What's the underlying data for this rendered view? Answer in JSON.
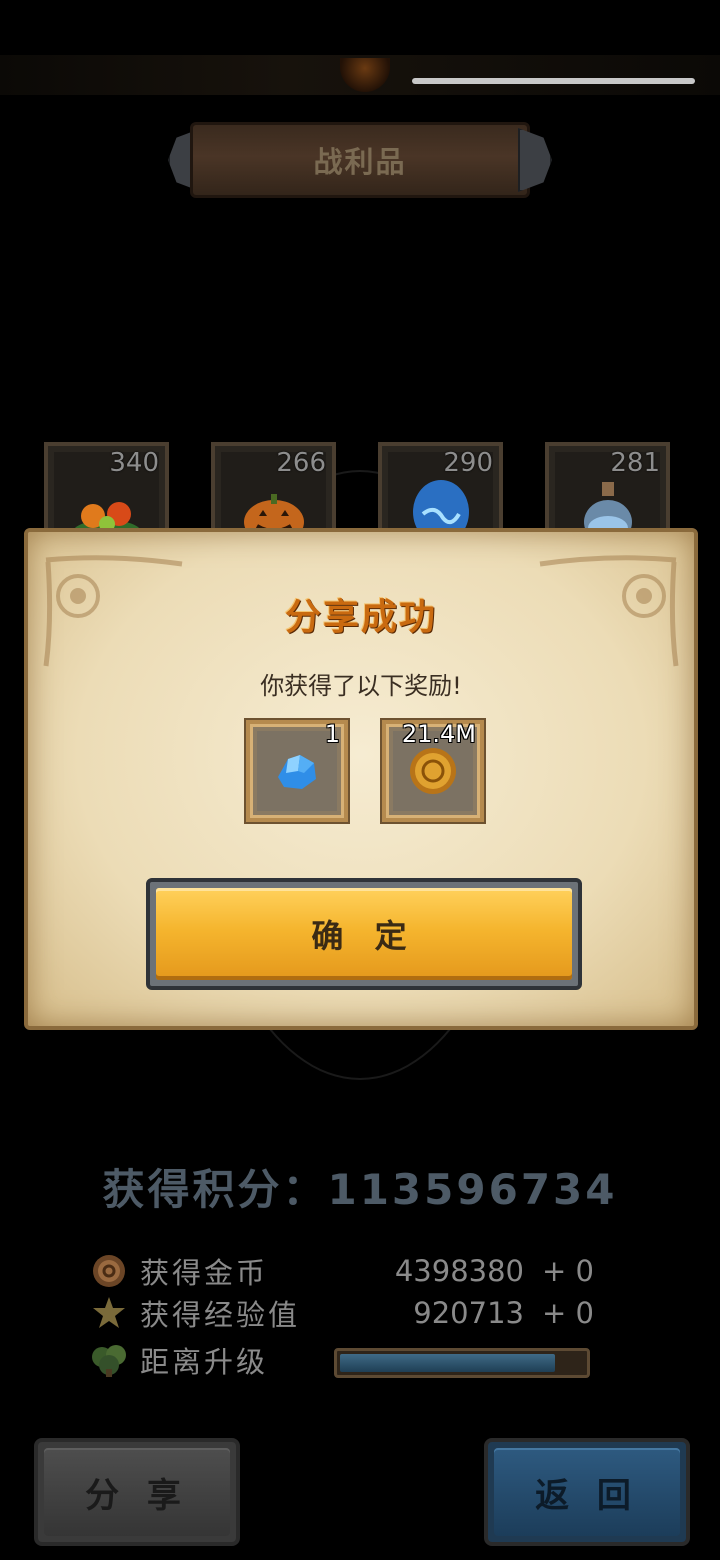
{
  "header": {
    "title": "战利品"
  },
  "loot": [
    {
      "count": "340",
      "icon": "fruit-bundle-icon"
    },
    {
      "count": "266",
      "icon": "pumpkin-icon"
    },
    {
      "count": "290",
      "icon": "blue-egg-icon"
    },
    {
      "count": "281",
      "icon": "potion-bottle-icon"
    }
  ],
  "dialog": {
    "title": "分享成功",
    "subtitle": "你获得了以下奖励!",
    "rewards": [
      {
        "qty": "1",
        "icon": "blue-crystal-icon"
      },
      {
        "qty": "21.4M",
        "icon": "gold-coin-icon"
      }
    ],
    "confirm_label": "确 定"
  },
  "score": {
    "text": "获得积分：113596734"
  },
  "stats": [
    {
      "label": "获得金币",
      "value": "4398380",
      "plus": "+ 0",
      "icon": "coin-icon"
    },
    {
      "label": "获得经验值",
      "value": "920713",
      "plus": "+ 0",
      "icon": "star-icon"
    },
    {
      "label": "距离升级",
      "progress": 0.88,
      "icon": "tree-icon"
    }
  ],
  "buttons": {
    "share_label": "分 享",
    "back_label": "返 回"
  },
  "colors": {
    "accent_orange": "#f5b52e",
    "title_orange": "#c96a10",
    "back_blue": "#2e5a80"
  }
}
